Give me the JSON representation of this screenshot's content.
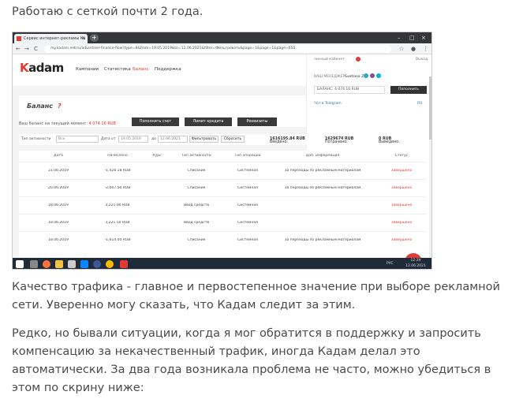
{
  "text": {
    "p1": "Работаю с сеткой почти 2 года.",
    "p2": "Качество трафика - главное и первостепенное значение при выборе рекламной сети. Уверенно могу сказать, что Кадам следит за этим.",
    "p3": "Редко, но бывали ситуации, когда я мог обратится в поддержку и запросить компенсацию за некачественный трафик, иногда Кадам делал это автоматически. За два года возникала проблема не часто, можно убедиться в этом по скрину ниже:"
  },
  "browser": {
    "tab_title": "Сервис интернет-рекламы Ка",
    "tab_close": "×",
    "new_tab": "+",
    "window_controls": [
      "–",
      "□",
      "×"
    ],
    "nav_icons": [
      "←",
      "→",
      "C"
    ],
    "url": "my.kadam.net/ru/advertiser-finance-flow?type=8&from=19.05.2019&to=12.06.2021&filter=Фильтровать&page=1&page=1&page=650"
  },
  "app": {
    "logo_k": "K",
    "logo_rest": "adam",
    "nav": [
      {
        "label": "Кампании"
      },
      {
        "label": "Статистика"
      },
      {
        "label": "Баланс",
        "active": true
      },
      {
        "label": "Поддержка"
      }
    ],
    "right_panel": {
      "user_label": "личный кабинет",
      "exit": "Выход",
      "manager_label": "ВАШ МЕНЕДЖЕР:",
      "manager_name": "Svetlana Z",
      "balance_label": "БАЛАНС:",
      "balance_value": "4 074.16 RUB",
      "topup": "Пополнить",
      "telegram": "Чат в Telegram",
      "lang": "RU"
    },
    "balance": {
      "title": "Баланс",
      "help": "?",
      "current_label": "Ваш баланс на текущий момент:",
      "current_value": "4 074.16 RUB",
      "btn_topup": "Пополнить счет",
      "btn_credit": "Лимит кредита",
      "btn_details": "Реквизиты"
    },
    "filters": {
      "type_label": "Тип активности",
      "type_value": "Все",
      "date_label": "Дата от",
      "date_from": "19.05.2019",
      "date_to_label": "до",
      "date_to": "12.06.2021",
      "filter_btn": "Фильтровать",
      "reset_btn": "Сбросить",
      "income_label": "Введено:",
      "income_value": "1616195.84 RUB",
      "spent_label": "Потрачено:",
      "spent_value": "1629674 RUB",
      "withdrawn_label": "Выведено:",
      "withdrawn_value": "0 RUB"
    },
    "table": {
      "headers": [
        "Дата",
        "Начислено",
        "Курс",
        "Тип активности",
        "Тип операции",
        "Доп. информация",
        "Статус"
      ],
      "rows": [
        [
          "21.06.2019",
          "-1,426.18 RUB",
          "",
          "Списание",
          "Системная",
          "За переходы по рекламным материалам",
          "Завершено"
        ],
        [
          "20.06.2019",
          "-2,007.50 RUB",
          "",
          "Списание",
          "Системная",
          "За переходы по рекламным материалам",
          "Завершено"
        ],
        [
          "18.06.2019",
          "3,221.00 RUB",
          "",
          "Ввод средств",
          "Системная",
          "",
          "Завершено"
        ],
        [
          "18.06.2019",
          "3,221.50 RUB",
          "",
          "Ввод средств",
          "Системная",
          "",
          "Завершено"
        ],
        [
          "18.06.2019",
          "-1,614.00 RUB",
          "",
          "Списание",
          "Системная",
          "За переходы по рекламным материалам",
          "Завершено"
        ]
      ]
    },
    "watermark": "partnerkin",
    "colors": {
      "accent": "#e53935",
      "dark_button": "#3a3a3a"
    }
  },
  "taskbar": {
    "lang": "РУС",
    "time": "12:29",
    "date": "12.06.2021"
  }
}
